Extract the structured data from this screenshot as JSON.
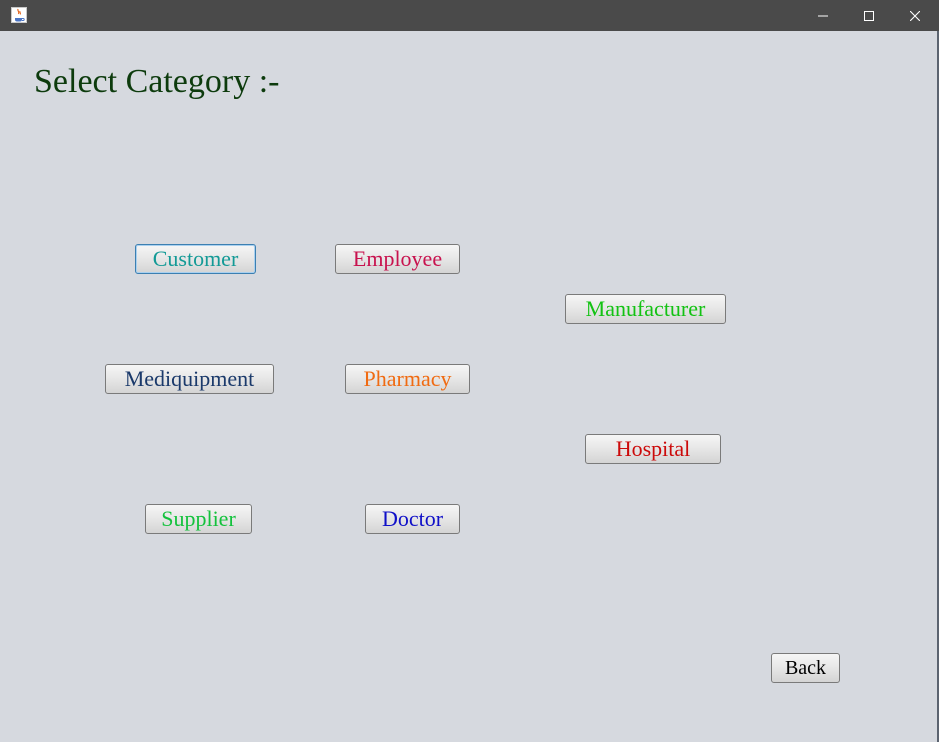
{
  "window": {
    "app_icon": "java-app-icon",
    "controls": {
      "minimize": "minimize-icon",
      "maximize": "maximize-icon",
      "close": "close-icon"
    }
  },
  "main": {
    "title": "Select Category :-",
    "categories": [
      {
        "id": "customer",
        "label": "Customer",
        "color": "#139a96"
      },
      {
        "id": "employee",
        "label": "Employee",
        "color": "#c8124e"
      },
      {
        "id": "manufacturer",
        "label": "Manufacturer",
        "color": "#13c213"
      },
      {
        "id": "mediquipment",
        "label": "Mediquipment",
        "color": "#1b3a6b"
      },
      {
        "id": "pharmacy",
        "label": "Pharmacy",
        "color": "#f06b12"
      },
      {
        "id": "hospital",
        "label": "Hospital",
        "color": "#cc0a0a"
      },
      {
        "id": "supplier",
        "label": "Supplier",
        "color": "#13c23c"
      },
      {
        "id": "doctor",
        "label": "Doctor",
        "color": "#1010c8"
      }
    ],
    "back_label": "Back"
  },
  "colors": {
    "background": "#d6d9df",
    "titlebar": "#4a4a4a",
    "title_text": "#0d3b0d"
  }
}
